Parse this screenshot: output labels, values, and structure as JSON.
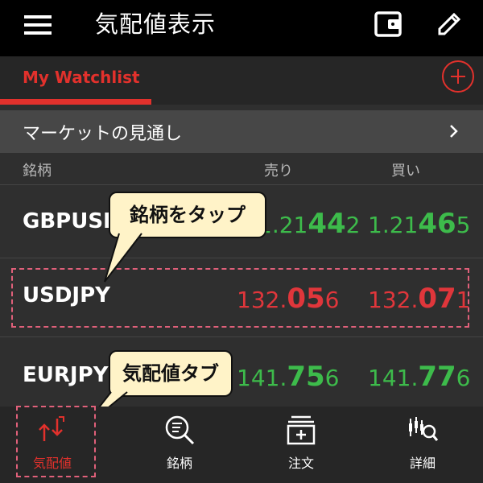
{
  "appbar": {
    "title": "気配値表示",
    "menu_icon": "menu-icon",
    "wallet_icon": "wallet-icon",
    "edit_icon": "edit-icon"
  },
  "tabs": {
    "active_label": "My Watchlist",
    "add_icon": "add-circle-icon"
  },
  "market": {
    "label": "マーケットの見通し",
    "chevron_icon": "chevron-right-icon"
  },
  "columns": {
    "symbol": "銘柄",
    "sell": "売り",
    "buy": "買い"
  },
  "rows": [
    {
      "symbol": "GBPUSD",
      "sell": {
        "pre": "1.21",
        "big": "44",
        "post": "2"
      },
      "buy": {
        "pre": "1.21",
        "big": "46",
        "post": "5"
      },
      "direction": "up"
    },
    {
      "symbol": "USDJPY",
      "sell": {
        "pre": "132.",
        "big": "05",
        "post": "6"
      },
      "buy": {
        "pre": "132.",
        "big": "07",
        "post": "1"
      },
      "direction": "down"
    },
    {
      "symbol": "EURJPY",
      "sell": {
        "pre": "141.",
        "big": "75",
        "post": "6"
      },
      "buy": {
        "pre": "141.",
        "big": "77",
        "post": "6"
      },
      "direction": "up"
    }
  ],
  "callouts": {
    "tap_symbol": "銘柄をタップ",
    "quote_tab": "気配値タブ"
  },
  "nav": [
    {
      "label": "気配値",
      "icon": "swap-arrows-icon",
      "active": true
    },
    {
      "label": "銘柄",
      "icon": "search-list-icon",
      "active": false
    },
    {
      "label": "注文",
      "icon": "order-add-icon",
      "active": false
    },
    {
      "label": "詳細",
      "icon": "candlestick-search-icon",
      "active": false
    }
  ],
  "colors": {
    "accent": "#e2312c",
    "up": "#3dbb4b",
    "down": "#e0363b",
    "callout_bg": "#fff3c8"
  }
}
